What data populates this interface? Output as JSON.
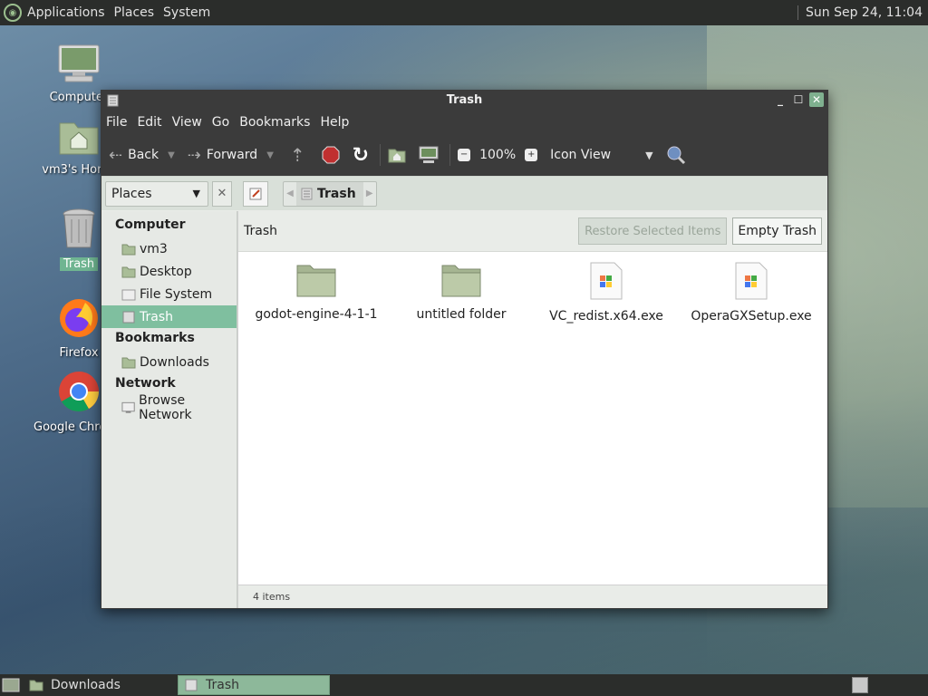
{
  "top_panel": {
    "menus": [
      "Applications",
      "Places",
      "System"
    ],
    "clock": "Sun Sep 24, 11:04"
  },
  "desktop_icons": [
    {
      "label": "Computer",
      "icon": "computer-icon"
    },
    {
      "label": "vm3's Home",
      "icon": "home-folder-icon"
    },
    {
      "label": "Trash",
      "icon": "trash-icon",
      "selected": true
    },
    {
      "label": "Firefox",
      "icon": "firefox-icon"
    },
    {
      "label": "Google Chrome",
      "icon": "chrome-icon"
    }
  ],
  "window": {
    "title": "Trash",
    "menu": [
      "File",
      "Edit",
      "View",
      "Go",
      "Bookmarks",
      "Help"
    ],
    "toolbar": {
      "back": "Back",
      "forward": "Forward",
      "zoom": "100%",
      "view_mode": "Icon View"
    },
    "location": {
      "places_label": "Places",
      "crumb": "Trash"
    },
    "sidebar": {
      "computer_header": "Computer",
      "computer_items": [
        "vm3",
        "Desktop",
        "File System",
        "Trash"
      ],
      "bookmarks_header": "Bookmarks",
      "bookmark_items": [
        "Downloads"
      ],
      "network_header": "Network",
      "network_items": [
        "Browse Network"
      ]
    },
    "content": {
      "header": "Trash",
      "restore_button": "Restore Selected Items",
      "empty_button": "Empty Trash",
      "files": [
        {
          "name": "godot-engine-4-1-1",
          "type": "folder"
        },
        {
          "name": "untitled folder",
          "type": "folder"
        },
        {
          "name": "VC_redist.x64.exe",
          "type": "exe"
        },
        {
          "name": "OperaGXSetup.exe",
          "type": "exe"
        }
      ],
      "status": "4 items"
    }
  },
  "taskbar": {
    "items": [
      "Downloads",
      "Trash"
    ]
  },
  "colors": {
    "accent": "#7fbf9f",
    "panel": "#2b2d2b",
    "window_chrome": "#3b3b3b"
  }
}
